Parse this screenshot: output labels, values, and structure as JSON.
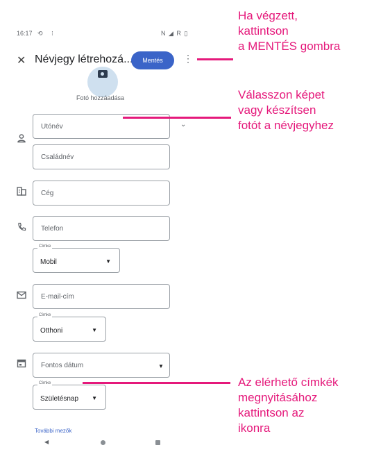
{
  "status_bar": {
    "time": "16:17",
    "icons_left": "⟲",
    "icons_left2": "⁝",
    "icons_right": "N ◢ R ▯"
  },
  "app_bar": {
    "title": "Névjegy létrehozá...",
    "save_label": "Mentés",
    "more_icon": "⋮",
    "close_icon": "✕"
  },
  "photo": {
    "label": "Fotó hozzáadása"
  },
  "fields": {
    "first_name": "Utónév",
    "last_name": "Családnév",
    "company": "Cég",
    "phone": "Telefon",
    "phone_label_caption": "Címke",
    "phone_label_value": "Mobil",
    "email": "E-mail-cím",
    "email_label_caption": "Címke",
    "email_label_value": "Otthoni",
    "date": "Fontos dátum",
    "date_label_caption": "Címke",
    "date_label_value": "Születésnap"
  },
  "more_fields": "További mezők",
  "callouts": {
    "save": "Ha végzett,\nkattintson\na MENTÉS gombra",
    "photo": "Válasszon képet\nvagy készítsen\nfotót a névjegyhez",
    "labels": "Az elérhető címkék\nmegnyitásához\nkattintson az\nikonra"
  },
  "colors": {
    "accent": "#e5197b",
    "primary": "#3b64c8"
  },
  "icons": [
    "close-icon",
    "more-icon",
    "camera-icon",
    "person-icon",
    "business-icon",
    "phone-icon",
    "email-icon",
    "calendar-icon",
    "back-nav-icon",
    "home-nav-icon",
    "recents-nav-icon"
  ]
}
